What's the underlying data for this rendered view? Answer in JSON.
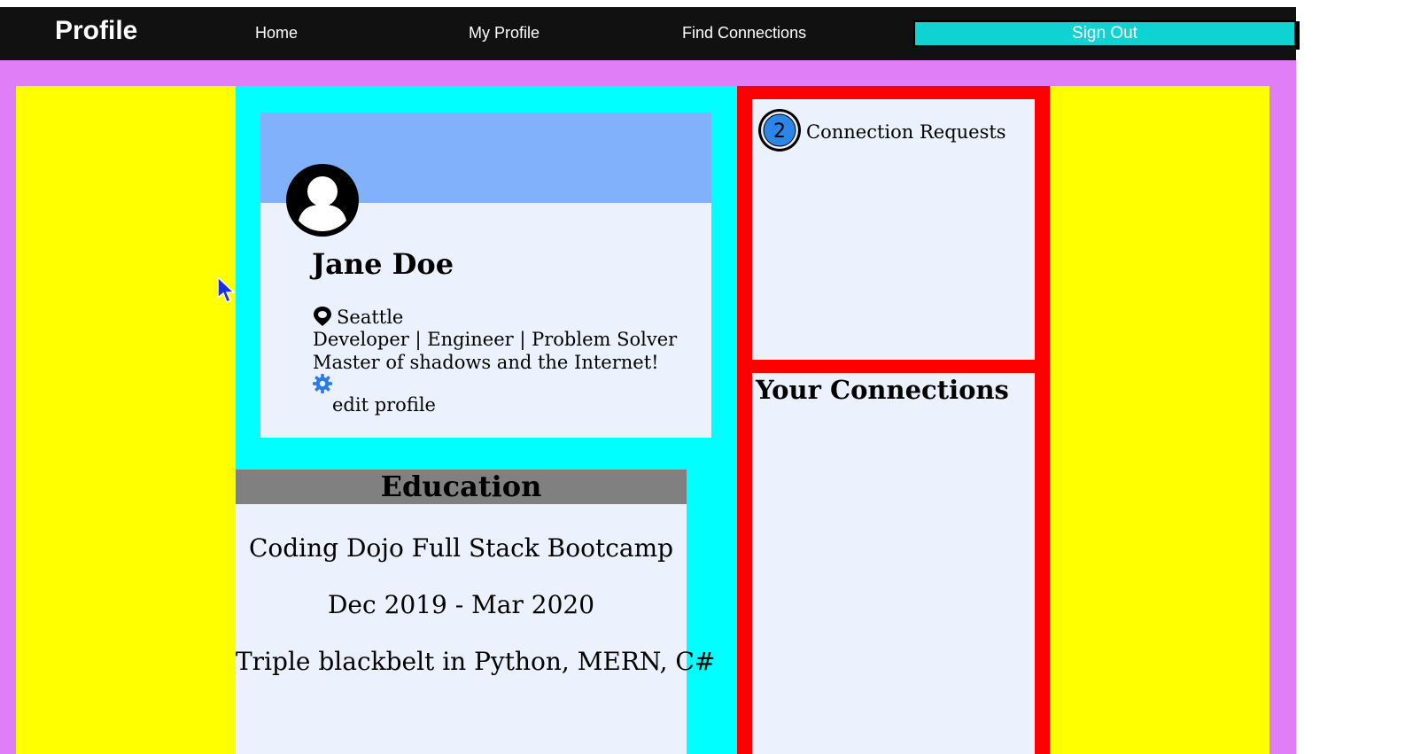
{
  "nav": {
    "brand": "Profile",
    "links": [
      "Home",
      "My Profile",
      "Find Connections"
    ],
    "signout": "Sign Out"
  },
  "profile": {
    "name": "Jane Doe",
    "location": "Seattle",
    "tagline": "Developer | Engineer | Problem Solver",
    "bio": "Master of shadows and the Internet!",
    "edit_label": "edit profile"
  },
  "education": {
    "header": "Education",
    "school": "Coding Dojo Full Stack Bootcamp",
    "dates": "Dec 2019 - Mar 2020",
    "note": "Triple blackbelt in Python, MERN, C#"
  },
  "requests": {
    "badge_count": "2",
    "label": "Connection Requests"
  },
  "connections": {
    "title": "Your Connections"
  },
  "colors": {
    "navbar": "#111111",
    "signout_bg": "#0fd2d2",
    "page_bg": "#e07ef8",
    "yellow": "#ffff00",
    "cyan": "#00ffff",
    "red": "#ff0000",
    "card_bg": "#ebf1fd",
    "banner": "#81b1fa",
    "edu_header": "#808080",
    "badge_blue": "#2c86e8",
    "gear_blue": "#2c7be5"
  },
  "icons": [
    "user-avatar-icon",
    "location-pin-icon",
    "gear-icon",
    "notification-badge",
    "mouse-cursor-icon"
  ]
}
